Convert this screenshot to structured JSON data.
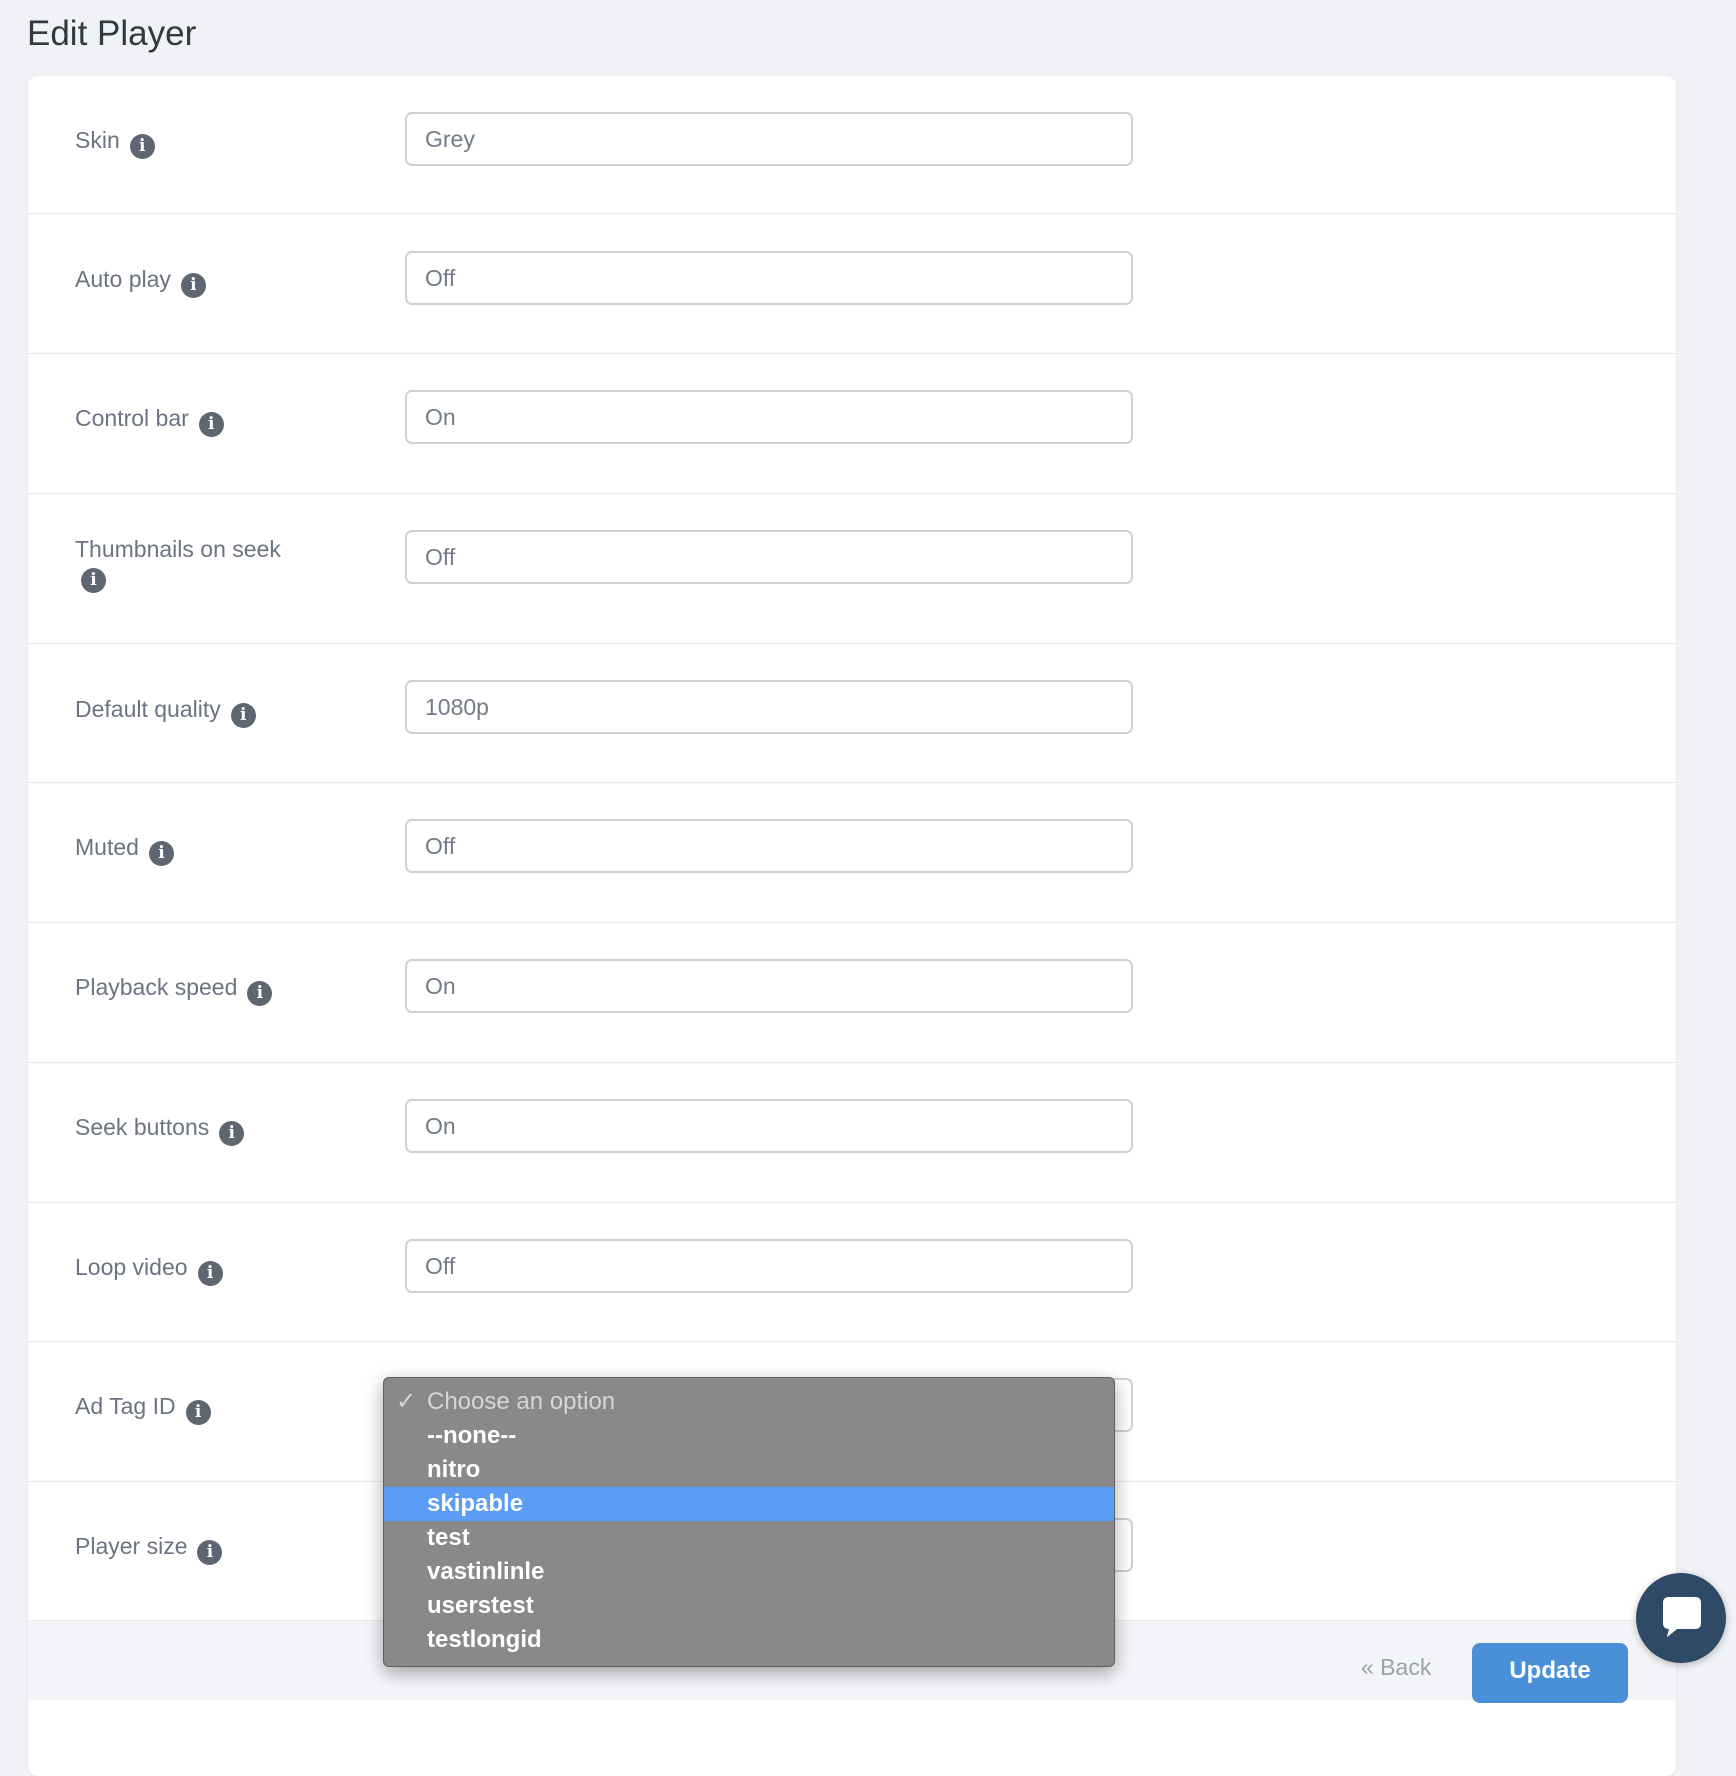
{
  "page": {
    "title": "Edit Player"
  },
  "settings": [
    {
      "label": "Skin",
      "value": "Grey"
    },
    {
      "label": "Auto play",
      "value": "Off"
    },
    {
      "label": "Control bar",
      "value": "On"
    },
    {
      "label": "Thumbnails on seek",
      "value": "Off"
    },
    {
      "label": "Default quality",
      "value": "1080p"
    },
    {
      "label": "Muted",
      "value": "Off"
    },
    {
      "label": "Playback speed",
      "value": "On"
    },
    {
      "label": "Seek buttons",
      "value": "On"
    },
    {
      "label": "Loop video",
      "value": "Off"
    },
    {
      "label": "Ad Tag ID",
      "value": ""
    },
    {
      "label": "Player size",
      "value": ""
    }
  ],
  "ad_tag_dropdown": {
    "placeholder": "Choose an option",
    "options": [
      "--none--",
      "nitro",
      "skipable",
      "test",
      "vastinlinle",
      "userstest",
      "testlongid"
    ],
    "highlighted": "skipable"
  },
  "footer": {
    "back_label": "« Back",
    "update_label": "Update"
  },
  "colors": {
    "accent": "#4a90d9",
    "highlight": "#5b9cf6",
    "chat": "#2f4a66"
  },
  "icons": {
    "info": "info-icon",
    "chat": "chat-icon",
    "check": "checkmark-icon"
  }
}
